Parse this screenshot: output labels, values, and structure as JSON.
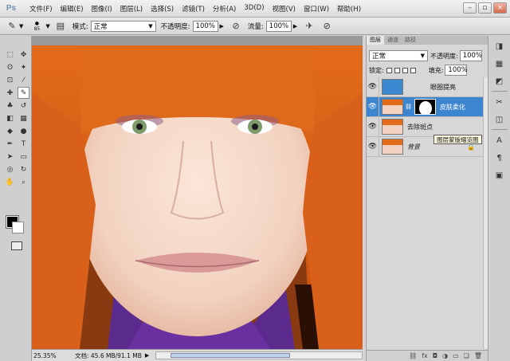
{
  "app": {
    "logo": "Ps"
  },
  "menu": [
    "文件(F)",
    "编辑(E)",
    "图像(I)",
    "图层(L)",
    "选择(S)",
    "滤镜(T)",
    "分析(A)",
    "3D(D)",
    "视图(V)",
    "窗口(W)",
    "帮助(H)"
  ],
  "window_controls": {
    "minimize": "–",
    "restore": "▫",
    "close": "×"
  },
  "options": {
    "brush_size": "85",
    "mode_label": "模式:",
    "mode_value": "正常",
    "opacity_label": "不透明度:",
    "opacity_value": "100%",
    "flow_label": "流量:",
    "flow_value": "100%"
  },
  "status": {
    "zoom": "25.35%",
    "doc": "文档: 45.6 MB/91.1 MB"
  },
  "layers_panel": {
    "tabs": [
      "图层",
      "通道",
      "路径"
    ],
    "blend_mode": "正常",
    "opacity_label": "不透明度:",
    "opacity_value": "100%",
    "lock_label": "锁定:",
    "fill_label": "填充:",
    "fill_value": "100%",
    "layers": [
      {
        "name": "眼圈提亮",
        "selected": false
      },
      {
        "name": "皮肤柔化",
        "selected": true
      },
      {
        "name": "去除斑点",
        "selected": false
      },
      {
        "name": "背景",
        "selected": false
      }
    ],
    "tooltip": "图层蒙版缩览图"
  },
  "colors": {
    "accent": "#3d86cf",
    "foreground": "#000000",
    "background": "#ffffff"
  }
}
